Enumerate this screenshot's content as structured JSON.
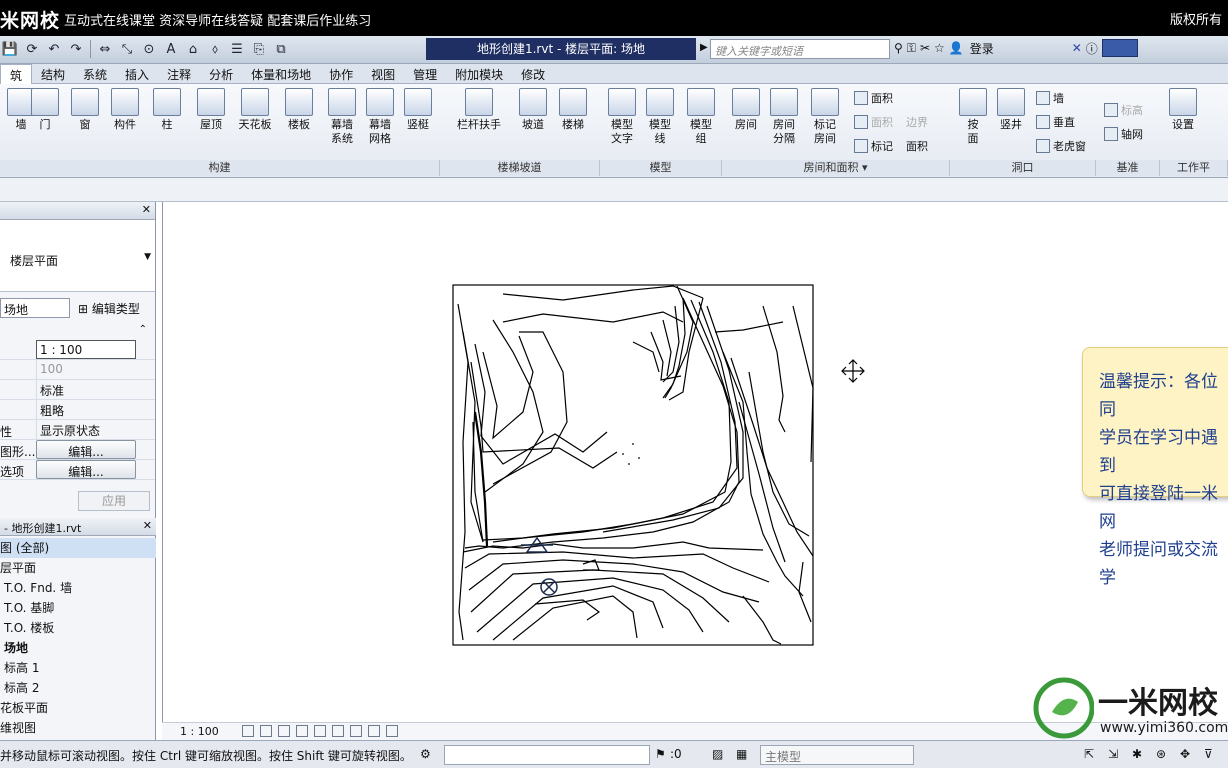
{
  "banner": {
    "logo": "米网校",
    "slogan": "互动式在线课堂  资深导师在线答疑  配套课后作业练习",
    "rights": "版权所有"
  },
  "titlebar": {
    "doc_title": "地形创建1.rvt - 楼层平面: 场地",
    "search_placeholder": "键入关键字或短语",
    "login": "登录"
  },
  "tabs": [
    "筑",
    "结构",
    "系统",
    "插入",
    "注释",
    "分析",
    "体量和场地",
    "协作",
    "视图",
    "管理",
    "附加模块",
    "修改"
  ],
  "ribbon": {
    "tools": [
      {
        "label": "墙",
        "sub": ""
      },
      {
        "label": "门",
        "sub": ""
      },
      {
        "label": "窗",
        "sub": ""
      },
      {
        "label": "构件",
        "sub": ""
      },
      {
        "label": "柱",
        "sub": ""
      },
      {
        "label": "屋顶",
        "sub": ""
      },
      {
        "label": "天花板",
        "sub": ""
      },
      {
        "label": "楼板",
        "sub": ""
      },
      {
        "label": "幕墙",
        "sub": "系统"
      },
      {
        "label": "幕墙",
        "sub": "网格"
      },
      {
        "label": "竖梃",
        "sub": ""
      },
      {
        "label": "栏杆扶手",
        "sub": ""
      },
      {
        "label": "坡道",
        "sub": ""
      },
      {
        "label": "楼梯",
        "sub": ""
      },
      {
        "label": "模型",
        "sub": "文字"
      },
      {
        "label": "模型",
        "sub": "线"
      },
      {
        "label": "模型",
        "sub": "组"
      },
      {
        "label": "房间",
        "sub": ""
      },
      {
        "label": "房间",
        "sub": "分隔"
      },
      {
        "label": "标记",
        "sub": "房间"
      },
      {
        "label": "按",
        "sub": "面"
      },
      {
        "label": "竖井",
        "sub": ""
      },
      {
        "label": "设置",
        "sub": ""
      }
    ],
    "small_items": [
      {
        "label": "面积",
        "disabled": false
      },
      {
        "label": "面积",
        "disabled": true
      },
      {
        "label": "边界",
        "disabled": true
      },
      {
        "label": "标记",
        "disabled": false
      },
      {
        "label": "面积",
        "disabled": false
      },
      {
        "label": "墙",
        "disabled": false
      },
      {
        "label": "垂直",
        "disabled": false
      },
      {
        "label": "老虎窗",
        "disabled": false
      },
      {
        "label": "标高",
        "disabled": true
      },
      {
        "label": "轴网",
        "disabled": false
      }
    ],
    "panels": [
      "构建",
      "楼梯坡道",
      "模型",
      "房间和面积 ▾",
      "洞口",
      "基准",
      "工作平"
    ]
  },
  "properties": {
    "title": "",
    "type_name": "楼层平面",
    "selector_value": "场地",
    "edit_type": "编辑类型",
    "rows": [
      {
        "key": "",
        "value": "1 : 100"
      },
      {
        "key": "",
        "value": "100"
      },
      {
        "key": "",
        "value": "标准"
      },
      {
        "key": "",
        "value": "粗略"
      },
      {
        "key": "性",
        "value": "显示原状态"
      },
      {
        "key": "图形...",
        "value": "编辑..."
      },
      {
        "key": "选项",
        "value": "编辑..."
      }
    ],
    "apply": "应用"
  },
  "browser": {
    "title": "- 地形创建1.rvt",
    "items": [
      {
        "text": "图 (全部)",
        "bold": false,
        "hl": true
      },
      {
        "text": "层平面",
        "bold": false,
        "hl": false
      },
      {
        "text": "T.O. Fnd. 墙",
        "bold": false,
        "hl": false
      },
      {
        "text": "T.O. 基脚",
        "bold": false,
        "hl": false
      },
      {
        "text": "T.O. 楼板",
        "bold": false,
        "hl": false
      },
      {
        "text": "场地",
        "bold": true,
        "hl": false
      },
      {
        "text": "标高 1",
        "bold": false,
        "hl": false
      },
      {
        "text": "标高 2",
        "bold": false,
        "hl": false
      },
      {
        "text": "花板平面",
        "bold": false,
        "hl": false
      },
      {
        "text": "维视图",
        "bold": false,
        "hl": false
      }
    ]
  },
  "viewctl": {
    "scale": "1 : 100"
  },
  "status": {
    "message": "并移动鼠标可滚动视图。按住 Ctrl 键可缩放视图。按住 Shift 键可旋转视图。",
    "zero": ":0",
    "model": "主模型"
  },
  "notice": {
    "lines": [
      "温馨提示：各位同",
      "学员在学习中遇到",
      "可直接登陆一米网",
      "老师提问或交流学"
    ]
  },
  "watermark": {
    "brand": "一米网校",
    "url": "www.yimi360.com"
  },
  "colors": {
    "accent": "#1f2f63",
    "notice_text": "#1f3f8f",
    "notice_bg": "#fdf3c4"
  }
}
